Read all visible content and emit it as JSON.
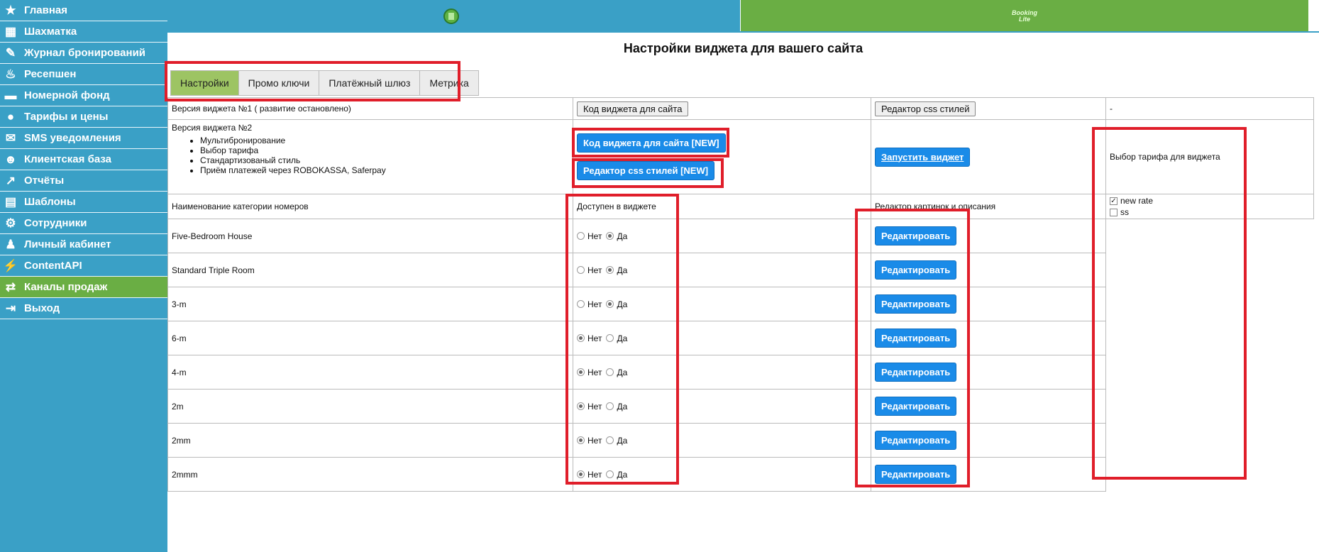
{
  "sidebar": {
    "items": [
      {
        "label": "Главная",
        "icon": "star-icon",
        "glyph": "★"
      },
      {
        "label": "Шахматка",
        "icon": "chessboard-icon",
        "glyph": "▦"
      },
      {
        "label": "Журнал бронирований",
        "icon": "journal-icon",
        "glyph": "✎"
      },
      {
        "label": "Ресепшен",
        "icon": "reception-icon",
        "glyph": "♨"
      },
      {
        "label": "Номерной фонд",
        "icon": "bed-icon",
        "glyph": "▬"
      },
      {
        "label": "Тарифы и цены",
        "icon": "money-bag-icon",
        "glyph": "●"
      },
      {
        "label": "SMS уведомления",
        "icon": "sms-icon",
        "glyph": "✉"
      },
      {
        "label": "Клиентская база",
        "icon": "clients-icon",
        "glyph": "☻"
      },
      {
        "label": "Отчёты",
        "icon": "chart-icon",
        "glyph": "↗"
      },
      {
        "label": "Шаблоны",
        "icon": "template-icon",
        "glyph": "▤"
      },
      {
        "label": "Сотрудники",
        "icon": "gear-icon",
        "glyph": "⚙"
      },
      {
        "label": "Личный кабинет",
        "icon": "user-icon",
        "glyph": "♟"
      },
      {
        "label": "ContentAPI",
        "icon": "api-icon",
        "glyph": "⚡"
      },
      {
        "label": "Каналы продаж",
        "icon": "channels-icon",
        "glyph": "⇄"
      },
      {
        "label": "Выход",
        "icon": "exit-icon",
        "glyph": "⇥"
      }
    ],
    "active_index": 13
  },
  "topbar": {
    "booking_logo_line1": "Booking",
    "booking_logo_line2": "Lite"
  },
  "page_title": "Настройки виджета для вашего сайта",
  "tabs": [
    {
      "label": "Настройки",
      "active": true
    },
    {
      "label": "Промо ключи",
      "active": false
    },
    {
      "label": "Платёжный шлюз",
      "active": false
    },
    {
      "label": "Метрика",
      "active": false
    }
  ],
  "widget_v1": {
    "label": "Версия виджета №1 ( развитие остановлено)",
    "code_button": "Код виджета для сайта",
    "css_button": "Редактор css стилей",
    "note": "-"
  },
  "widget_v2": {
    "label": "Версия виджета №2",
    "features": [
      "Мультибронирование",
      "Выбор тарифа",
      "Стандартизованый стиль",
      "Приём платежей через ROBOKASSA, Saferpay"
    ],
    "code_button": "Код виджета для сайта [NEW]",
    "css_button": "Редактор css стилей [NEW]",
    "launch_button": "Запустить виджет",
    "tariff_label": "Выбор тарифа для виджета"
  },
  "table": {
    "col_name": "Наименование категории номеров",
    "col_available": "Доступен в виджете",
    "col_editor": "Редактор картинок и описания",
    "no_label": "Нет",
    "yes_label": "Да",
    "edit_label": "Редактировать",
    "rows": [
      {
        "name": "Five-Bedroom House",
        "available": "yes"
      },
      {
        "name": "Standard Triple Room",
        "available": "yes"
      },
      {
        "name": "3-m",
        "available": "yes"
      },
      {
        "name": "6-m",
        "available": "no"
      },
      {
        "name": "4-m",
        "available": "no"
      },
      {
        "name": "2m",
        "available": "no"
      },
      {
        "name": "2mm",
        "available": "no"
      },
      {
        "name": "2mmm",
        "available": "no"
      }
    ]
  },
  "tariffs": [
    {
      "name": "new rate",
      "checked": true
    },
    {
      "name": "ss",
      "checked": false
    }
  ],
  "colors": {
    "sidebar": "#3aa0c6",
    "active_green": "#6aae44",
    "button_blue": "#1a8be8",
    "highlight_red": "#e01e2a"
  }
}
